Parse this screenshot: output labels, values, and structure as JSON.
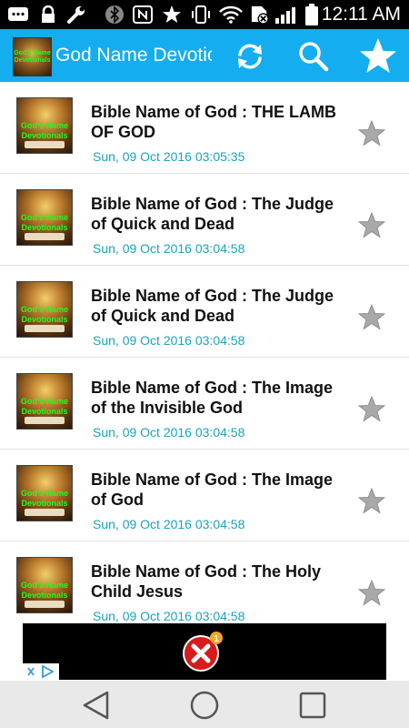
{
  "status_bar": {
    "time": "12:11 AM",
    "icons": [
      "message-icon",
      "lock-icon",
      "wrench-icon",
      "bluetooth-icon",
      "nfc-icon",
      "star-icon",
      "vibrate-icon",
      "wifi-icon",
      "sim-icon",
      "signal-icon",
      "battery-icon"
    ]
  },
  "app_bar": {
    "title": "God Name Devotionals",
    "logo_text": "God's Name Devotionals",
    "actions": [
      "refresh-icon",
      "search-icon",
      "favorites-star-icon"
    ]
  },
  "colors": {
    "app_bar": "#14adf0",
    "date_text": "#19a3bf",
    "thumb_text": "#1cff1c",
    "star": "#a9a9a9"
  },
  "items": [
    {
      "title": "Bible Name of God : THE LAMB OF GOD",
      "date": "Sun, 09 Oct 2016 03:05:35",
      "thumb_text": "God's Name Devotionals"
    },
    {
      "title": "Bible Name of God : The Judge of Quick and Dead",
      "date": "Sun, 09 Oct 2016 03:04:58",
      "thumb_text": "God's Name Devotionals"
    },
    {
      "title": "Bible Name of God : The Judge of Quick and Dead",
      "date": "Sun, 09 Oct 2016 03:04:58",
      "thumb_text": "God's Name Devotionals"
    },
    {
      "title": "Bible Name of God : The Image of the Invisible God",
      "date": "Sun, 09 Oct 2016 03:04:58",
      "thumb_text": "God's Name Devotionals"
    },
    {
      "title": "Bible Name of God : The Image of God",
      "date": "Sun, 09 Oct 2016 03:04:58",
      "thumb_text": "God's Name Devotionals"
    },
    {
      "title": "Bible Name of God : The Holy Child Jesus",
      "date": "Sun, 09 Oct 2016 03:04:58",
      "thumb_text": "God's Name Devotionals"
    }
  ],
  "ad": {
    "close_badge_count": "1"
  },
  "nav_bar": {
    "buttons": [
      "back-icon",
      "home-icon",
      "recents-icon"
    ]
  }
}
